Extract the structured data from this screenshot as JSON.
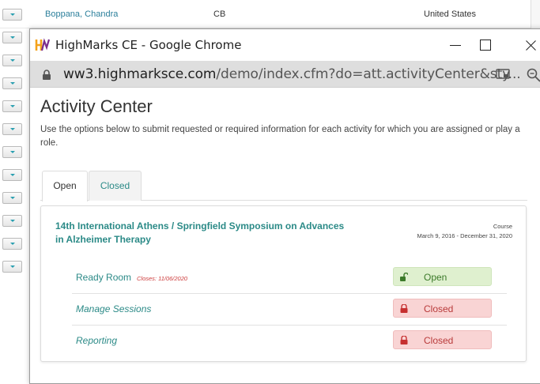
{
  "background_table": {
    "row": {
      "name": "Boppana, Chandra",
      "code": "CB",
      "country": "United States"
    }
  },
  "window": {
    "title": "HighMarks CE - Google Chrome",
    "logo_text": "HM",
    "url_host": "ww3.highmarksce.com",
    "url_path": "/demo/index.cfm?do=att.activityCenter&sty...",
    "icons": [
      "lock-icon",
      "cast-icon",
      "zoom-icon",
      "minimize-icon",
      "maximize-icon",
      "close-icon"
    ]
  },
  "page": {
    "heading": "Activity Center",
    "description": "Use the options below to submit requested or required information for each activity for which you are assigned or play a role.",
    "tabs": [
      {
        "label": "Open",
        "active": true
      },
      {
        "label": "Closed",
        "active": false
      }
    ]
  },
  "activity": {
    "title": "14th International Athens / Springfield Symposium on Advances in Alzheimer Therapy",
    "type": "Course",
    "dates": "March 9, 2016 - December 31, 2020",
    "rows": [
      {
        "label": "Ready Room",
        "note": "Closes: 11/06/2020",
        "status": "Open",
        "state": "open"
      },
      {
        "label": "Manage Sessions",
        "note": "",
        "status": "Closed",
        "state": "closed"
      },
      {
        "label": "Reporting",
        "note": "",
        "status": "Closed",
        "state": "closed"
      }
    ]
  },
  "colors": {
    "accent": "#2b8a87",
    "open_bg": "#dff0cf",
    "closed_bg": "#f9d4d4",
    "closed_text": "#b83a3a"
  }
}
